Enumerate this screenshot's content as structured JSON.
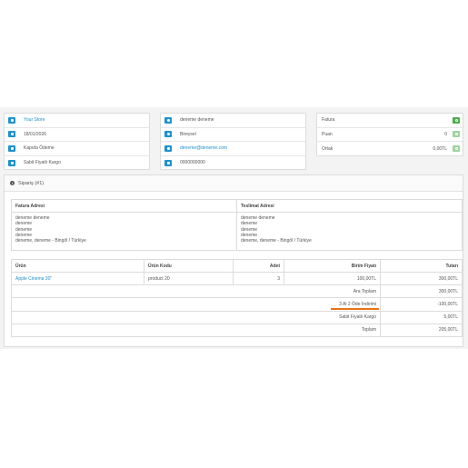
{
  "store_panel": {
    "rows": [
      {
        "icon": "cart-icon",
        "text": "Your Store",
        "link": true
      },
      {
        "icon": "calendar-icon",
        "text": "18/01/2026",
        "link": false
      },
      {
        "icon": "credit-card-icon",
        "text": "Kapıda Ödeme",
        "link": false
      },
      {
        "icon": "truck-icon",
        "text": "Sabit Fiyatlı Kargo",
        "link": false
      }
    ]
  },
  "customer_panel": {
    "rows": [
      {
        "icon": "user-icon",
        "text": "deneme deneme",
        "link": false
      },
      {
        "icon": "users-group-icon",
        "text": "Bireysel",
        "link": false
      },
      {
        "icon": "envelope-icon",
        "text": "deneme@deneme.com",
        "link": true
      },
      {
        "icon": "phone-icon",
        "text": "0000000000",
        "link": false
      }
    ]
  },
  "options_panel": {
    "rows": [
      {
        "label": "Fatura",
        "value": "",
        "button": "on"
      },
      {
        "label": "Puan",
        "value": "0",
        "button": "off"
      },
      {
        "label": "Ortak",
        "value": "0,00TL",
        "button": "off"
      }
    ]
  },
  "order": {
    "title": "Sipariş (#1)",
    "address_headers": [
      "Fatura Adresi",
      "Teslimat Adresi"
    ],
    "billing_lines": [
      "deneme deneme",
      "deneme",
      "deneme",
      "deneme",
      "deneme, deneme - Bingöl / Türkiye"
    ],
    "shipping_lines": [
      "deneme deneme",
      "deneme",
      "deneme",
      "deneme",
      "deneme, deneme - Bingöl / Türkiye"
    ],
    "columns": [
      "Ürün",
      "Ürün Kodu",
      "Adet",
      "Birim Fiyatı",
      "Tutarı"
    ],
    "product": {
      "name": "Apple Cinema 30\"",
      "code": "product 20",
      "qty": "3",
      "unit_price": "100,00TL",
      "total": "300,00TL"
    },
    "totals": [
      {
        "label": "Ara Toplam",
        "value": "300,00TL"
      },
      {
        "label": "3 Al 2 Öde İndirimi",
        "value": "-100,00TL"
      },
      {
        "label": "Sabit Fiyatlı Kargo",
        "value": "5,00TL"
      },
      {
        "label": "Toplam",
        "value": "205,00TL"
      }
    ],
    "highlight_color": "#e8741a"
  },
  "colors": {
    "primary": "#1e91cf",
    "success": "#4cae4c",
    "success_light": "#9fd39f"
  }
}
